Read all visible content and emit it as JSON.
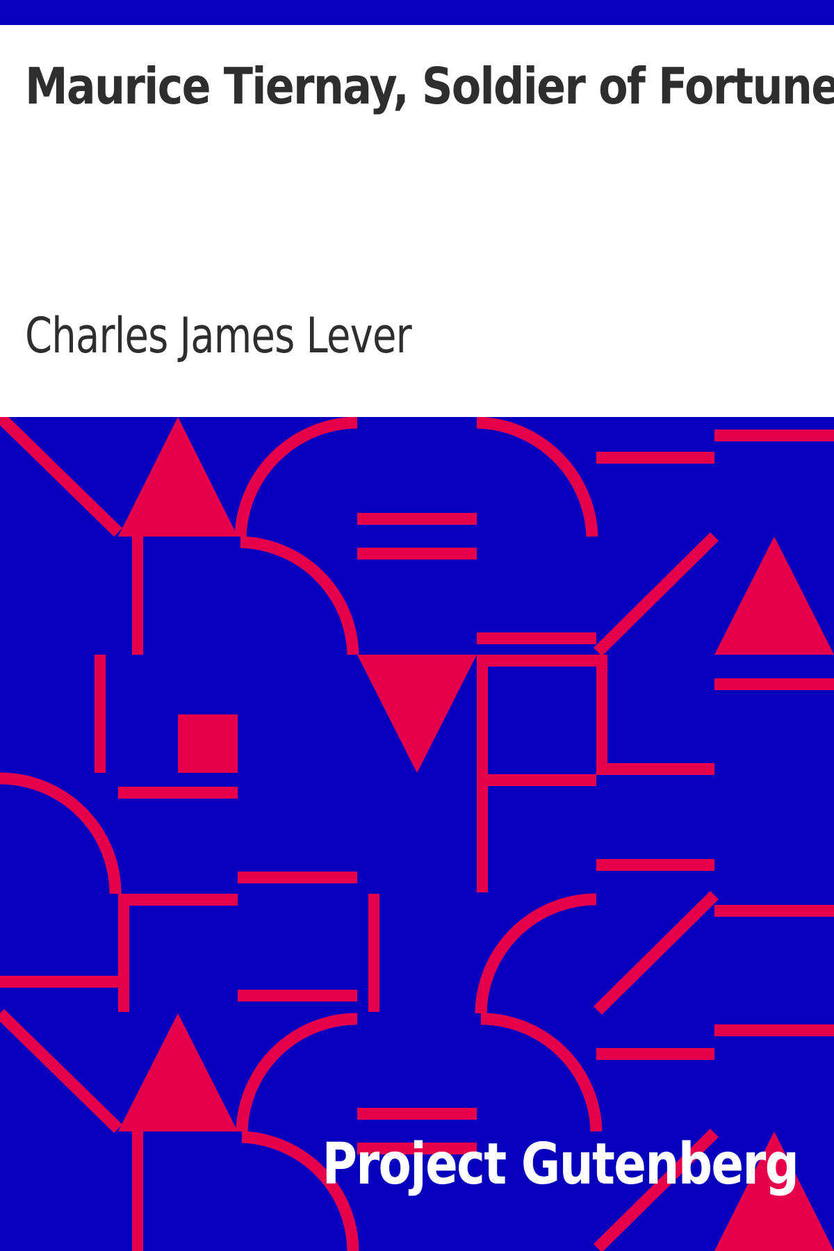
{
  "cover": {
    "title": "Maurice Tiernay, Soldier of Fortune",
    "author": "Charles James Lever",
    "publisher": "Project Gutenberg"
  },
  "colors": {
    "background_blue": "#0600bd",
    "accent_red": "#e6004b",
    "title_text": "#2e2e2e",
    "publisher_text": "#ffffff",
    "page_white": "#ffffff"
  },
  "icons": {
    "pattern": "geometric-pattern"
  }
}
